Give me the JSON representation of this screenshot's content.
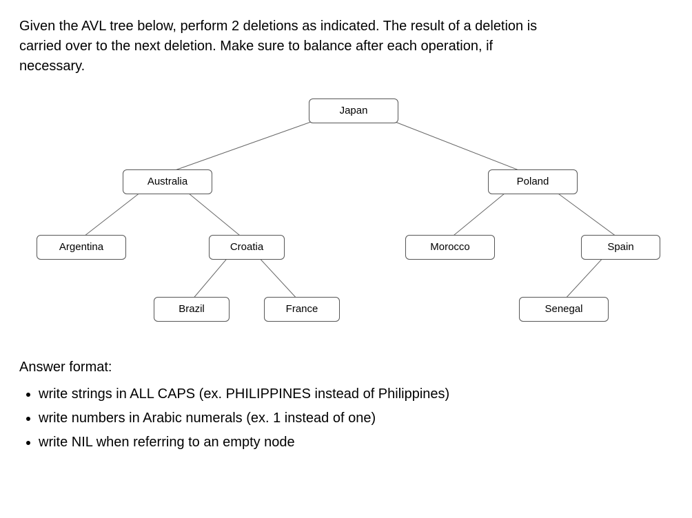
{
  "question": {
    "line1": "Given the AVL tree below, perform 2 deletions as indicated. The result of a deletion is",
    "line2": "carried over to the next deletion. Make sure to balance after each operation, if",
    "line3": "necessary."
  },
  "tree": {
    "nodes": {
      "japan": "Japan",
      "australia": "Australia",
      "poland": "Poland",
      "argentina": "Argentina",
      "croatia": "Croatia",
      "morocco": "Morocco",
      "spain": "Spain",
      "brazil": "Brazil",
      "france": "France",
      "senegal": "Senegal"
    }
  },
  "answer_heading": "Answer format:",
  "format_rules": {
    "r1": "write strings in ALL CAPS (ex. PHILIPPINES instead of Philippines)",
    "r2": "write numbers in Arabic numerals (ex. 1 instead of one)",
    "r3": "write NIL when referring to an empty node"
  }
}
